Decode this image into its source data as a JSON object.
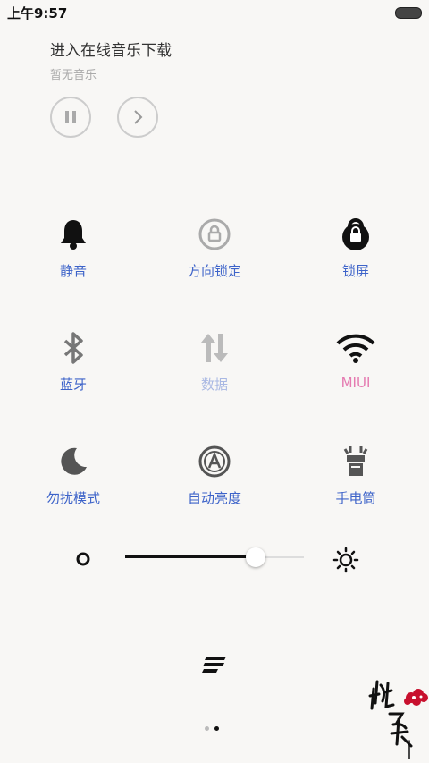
{
  "status": {
    "time": "上午9:57"
  },
  "music": {
    "title": "进入在线音乐下载",
    "subtitle": "暂无音乐"
  },
  "toggles": [
    {
      "label": "静音",
      "icon": "bell-icon"
    },
    {
      "label": "方向锁定",
      "icon": "rotation-lock-icon"
    },
    {
      "label": "锁屏",
      "icon": "lock-icon"
    },
    {
      "label": "蓝牙",
      "icon": "bluetooth-icon"
    },
    {
      "label": "数据",
      "icon": "data-icon"
    },
    {
      "label": "MIUI",
      "icon": "wifi-icon"
    },
    {
      "label": "勿扰模式",
      "icon": "moon-icon"
    },
    {
      "label": "自动亮度",
      "icon": "auto-brightness-icon"
    },
    {
      "label": "手电筒",
      "icon": "flashlight-icon"
    }
  ],
  "brightness": {
    "value": 0.73
  },
  "pager": {
    "pages": 2,
    "current": 2
  },
  "colors": {
    "label": "#3d63c9",
    "muted": "#a9b8e3",
    "pink": "#e57bb1"
  }
}
